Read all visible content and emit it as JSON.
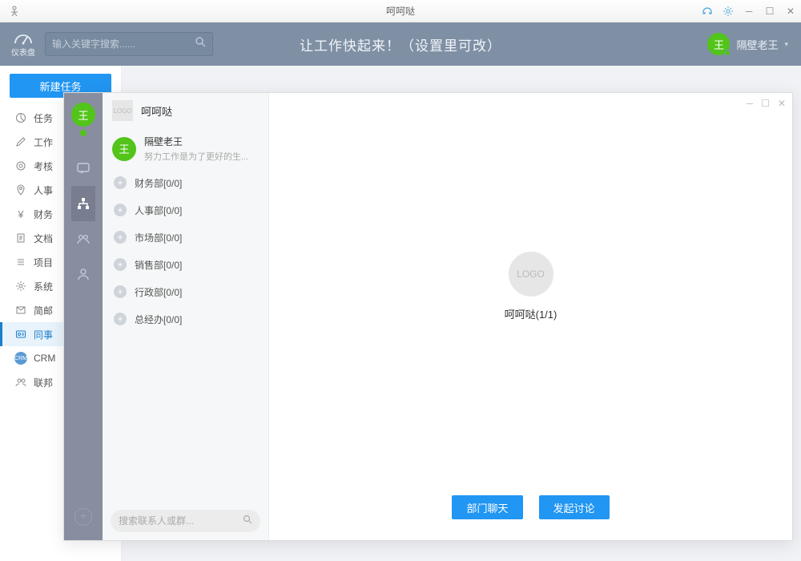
{
  "window": {
    "title": "呵呵哒"
  },
  "topbar": {
    "dashboard_label": "仪表盘",
    "search_placeholder": "输入关键字搜索......",
    "banner_text": "让工作快起来！（设置里可改）",
    "user_name": "隔壁老王",
    "user_initial": "王"
  },
  "leftnav": {
    "new_task_label": "新建任务",
    "items": [
      {
        "label": "任务",
        "icon": "pie"
      },
      {
        "label": "工作",
        "icon": "pencil"
      },
      {
        "label": "考核",
        "icon": "target"
      },
      {
        "label": "人事",
        "icon": "pin"
      },
      {
        "label": "财务",
        "icon": "yen"
      },
      {
        "label": "文档",
        "icon": "doc"
      },
      {
        "label": "项目",
        "icon": "list"
      },
      {
        "label": "系统",
        "icon": "gear"
      },
      {
        "label": "简邮",
        "icon": "mail"
      },
      {
        "label": "同事",
        "icon": "card",
        "active": true
      },
      {
        "label": "CRM",
        "icon": "crm"
      },
      {
        "label": "联邦",
        "icon": "people"
      }
    ]
  },
  "chat": {
    "org_title": "呵呵哒",
    "user_initial": "王",
    "current_user": {
      "name": "隔壁老王",
      "signature": "努力工作是为了更好的生..."
    },
    "departments": [
      {
        "label": "财务部[0/0]"
      },
      {
        "label": "人事部[0/0]"
      },
      {
        "label": "市场部[0/0]"
      },
      {
        "label": "销售部[0/0]"
      },
      {
        "label": "行政部[0/0]"
      },
      {
        "label": "总经办[0/0]"
      }
    ],
    "list_search_placeholder": "搜索联系人或群...",
    "main": {
      "logo_text": "LOGO",
      "title": "呵呵哒(1/1)",
      "btn_dept_chat": "部门聊天",
      "btn_start_discuss": "发起讨论"
    }
  }
}
